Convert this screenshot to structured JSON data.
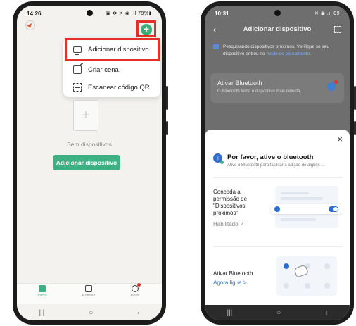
{
  "left_phone": {
    "status": {
      "time": "14:26",
      "icons": "▣ ✻ ✕ ◉ .ıl 79%▮"
    },
    "menu": {
      "items": [
        {
          "label": "Adicionar dispositivo",
          "icon": "device-icon"
        },
        {
          "label": "Criar cena",
          "icon": "edit-scene-icon"
        },
        {
          "label": "Escanear código QR",
          "icon": "scan-icon"
        }
      ]
    },
    "empty_state_text": "Sem dispositivos",
    "add_device_button": "Adicionar dispositivo",
    "tabs": [
      {
        "label": "Início",
        "icon": "home-icon"
      },
      {
        "label": "Rotinas",
        "icon": "checkbox-icon"
      },
      {
        "label": "Perfil",
        "icon": "profile-icon"
      }
    ],
    "nav": {
      "recents": "|||",
      "home": "○",
      "back": "‹"
    },
    "highlight_color": "#e5302a",
    "accent_color": "#3fb083"
  },
  "right_phone": {
    "status": {
      "time": "10:31",
      "icons": "✕ ◉ .ıl 89"
    },
    "header": {
      "title": "Adicionar dispositivo",
      "back": "‹"
    },
    "notice": {
      "text": "Pesquisando dispositivos próximos. Verifique se seu dispositivo entrou no ",
      "link": "modo de pareamento",
      "suffix": "."
    },
    "bluetooth_card": {
      "title": "Ativar Bluetooth",
      "subtitle": "O Bluetooth torna o dispositivo mais detectá..."
    },
    "sheet": {
      "close": "×",
      "title": "Por favor, ative o bluetooth",
      "subtitle": "Ative o Bluetooth para facilitar a adição de alguns ...",
      "permission_label": "Conceda a permissão de \"Dispositivos próximos\"",
      "permission_status": "Habilitado ✓",
      "activate_label": "Ativar Bluetooth",
      "activate_link": "Agora ligue >"
    },
    "nav": {
      "recents": "|||",
      "home": "○",
      "back": "‹"
    },
    "bluetooth_color": "#2f6fd1"
  }
}
